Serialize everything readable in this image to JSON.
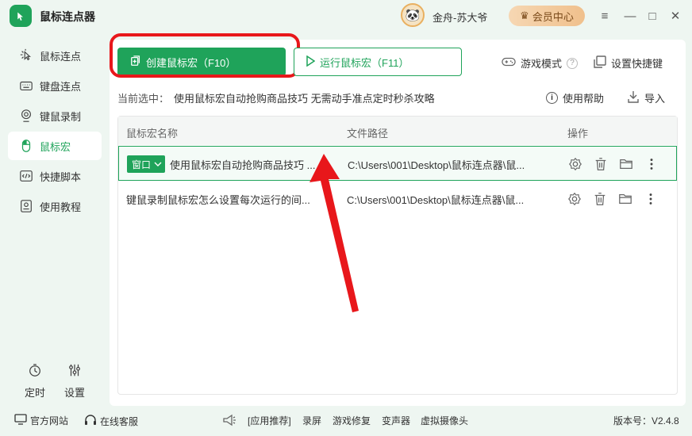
{
  "app": {
    "title": "鼠标连点器"
  },
  "user": {
    "name": "金舟-苏大爷"
  },
  "vip": {
    "label": "会员中心"
  },
  "window_controls": {
    "menu": "≡",
    "minimize": "—",
    "maximize": "□",
    "close": "✕"
  },
  "sidebar": {
    "items": [
      {
        "label": "鼠标连点",
        "icon": "mouse-click-icon"
      },
      {
        "label": "键盘连点",
        "icon": "keyboard-icon"
      },
      {
        "label": "键鼠录制",
        "icon": "record-icon"
      },
      {
        "label": "鼠标宏",
        "icon": "mouse-icon"
      },
      {
        "label": "快捷脚本",
        "icon": "script-icon"
      },
      {
        "label": "使用教程",
        "icon": "tutorial-icon"
      }
    ],
    "active_index": 3,
    "bottom": [
      {
        "label": "定时",
        "icon": "timer-icon"
      },
      {
        "label": "设置",
        "icon": "settings-icon"
      }
    ]
  },
  "toolbar": {
    "create_label": "创建鼠标宏（F10）",
    "run_label": "运行鼠标宏（F11）",
    "game_mode_label": "游戏模式",
    "shortcut_label": "设置快捷键",
    "help_label": "使用帮助",
    "import_label": "导入"
  },
  "current_selection": {
    "label": "当前选中：",
    "value": "使用鼠标宏自动抢购商品技巧 无需动手准点定时秒杀攻略"
  },
  "table": {
    "columns": [
      "鼠标宏名称",
      "文件路径",
      "操作"
    ],
    "rows": [
      {
        "tag": "窗口",
        "name": "使用鼠标宏自动抢购商品技巧 ...",
        "path": "C:\\Users\\001\\Desktop\\鼠标连点器\\鼠...",
        "selected": true
      },
      {
        "tag": "",
        "name": "键鼠录制鼠标宏怎么设置每次运行的间...",
        "path": "C:\\Users\\001\\Desktop\\鼠标连点器\\鼠...",
        "selected": false
      }
    ]
  },
  "footer": {
    "website": "官方网站",
    "support": "在线客服",
    "recommend": "[应用推荐]",
    "links": [
      "录屏",
      "游戏修复",
      "变声器",
      "虚拟摄像头"
    ],
    "version": "版本号：V2.4.8"
  },
  "colors": {
    "accent": "#1fa35a",
    "highlight": "#e8171b"
  }
}
